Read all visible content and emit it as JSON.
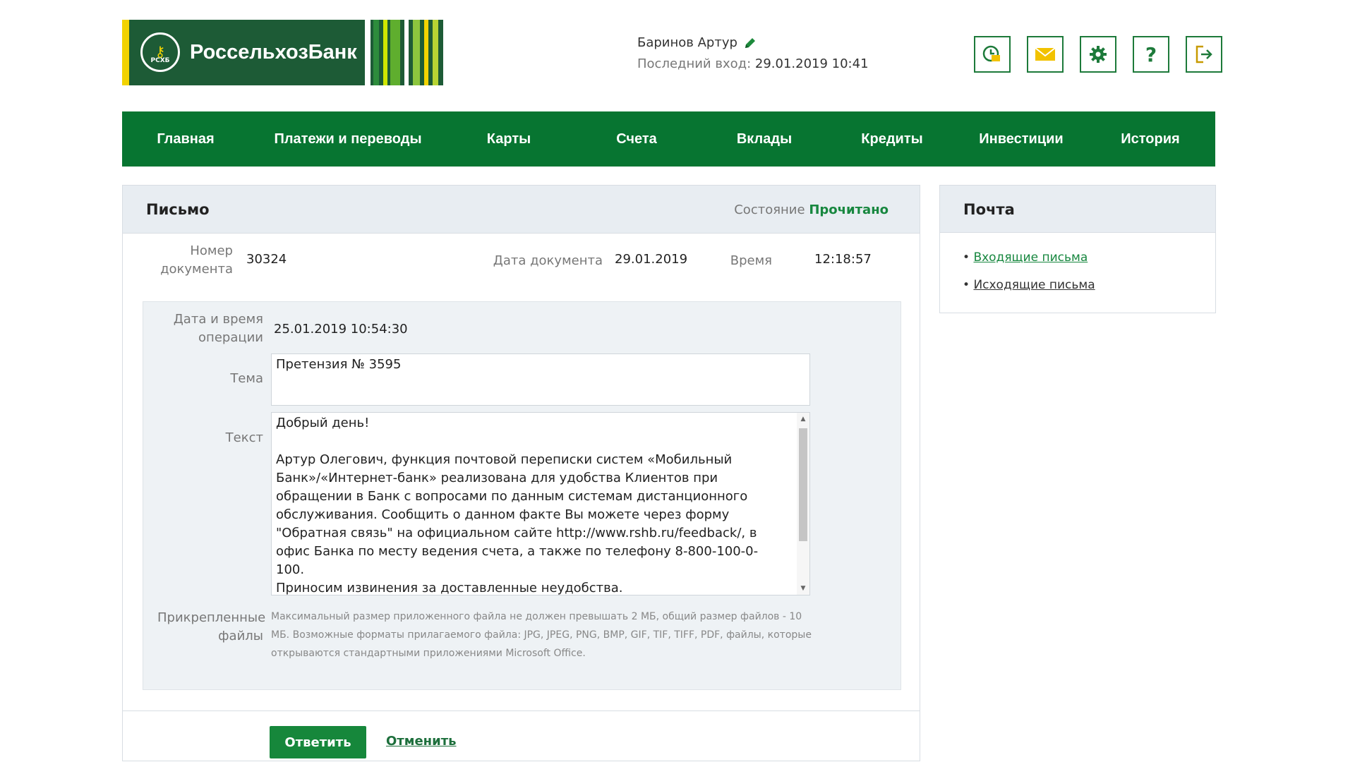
{
  "brand": {
    "name": "РоссельхозБанк",
    "emblem_text": "РСХБ",
    "colors": {
      "dark_green": "#1d5b36",
      "nav_green": "#077531",
      "yellow": "#f2d300",
      "accent_green": "#17873f"
    }
  },
  "user": {
    "name": "Баринов Артур",
    "last_login_label": "Последний вход:",
    "last_login_value": "29.01.2019 10:41",
    "edit_icon": "pencil-icon"
  },
  "toolbar_icons": [
    "history-icon",
    "mail-icon",
    "settings-gear-icon",
    "help-icon",
    "logout-icon"
  ],
  "help_glyph": "?",
  "nav": [
    {
      "label": "Главная"
    },
    {
      "label": "Платежи и переводы"
    },
    {
      "label": "Карты"
    },
    {
      "label": "Счета"
    },
    {
      "label": "Вклады"
    },
    {
      "label": "Кредиты"
    },
    {
      "label": "Инвестиции"
    },
    {
      "label": "История"
    }
  ],
  "letter": {
    "title": "Письмо",
    "state_label": "Состояние",
    "state_value": "Прочитано",
    "doc_number_label": "Номер документа",
    "doc_number": "30324",
    "doc_date_label": "Дата документа",
    "doc_date": "29.01.2019",
    "time_label": "Время",
    "time": "12:18:57",
    "op_datetime_label": "Дата и время операции",
    "op_datetime": "25.01.2019 10:54:30",
    "subject_label": "Тема",
    "subject": "Претензия № 3595",
    "text_label": "Текст",
    "text": "Добрый день!\n\nАртур Олегович, функция почтовой переписки систем «Мобильный Банк»/«Интернет-банк» реализована для удобства Клиентов при обращении в Банк с вопросами по данным системам дистанционного обслуживания. Сообщить о данном факте Вы можете через форму \"Обратная связь\" на официальном сайте http://www.rshb.ru/feedback/, в офис Банка по месту ведения счета, а также по телефону 8-800-100-0-100.\nПриносим извинения за доставленные неудобства.\nБлагодарим за обращение.",
    "attachments_label": "Прикрепленные файлы",
    "attachments_note": "Максимальный размер приложенного файла не должен превышать 2 МБ, общий размер файлов - 10 МБ. Возможные форматы прилагаемого файла: JPG, JPEG, PNG, BMP, GIF, TIF, TIFF, PDF, файлы, которые открываются стандартными приложениями Microsoft Office.",
    "reply_button": "Ответить",
    "cancel_link": "Отменить"
  },
  "mail": {
    "title": "Почта",
    "links": [
      {
        "label": "Входящие письма"
      },
      {
        "label": "Исходящие письма"
      }
    ]
  }
}
